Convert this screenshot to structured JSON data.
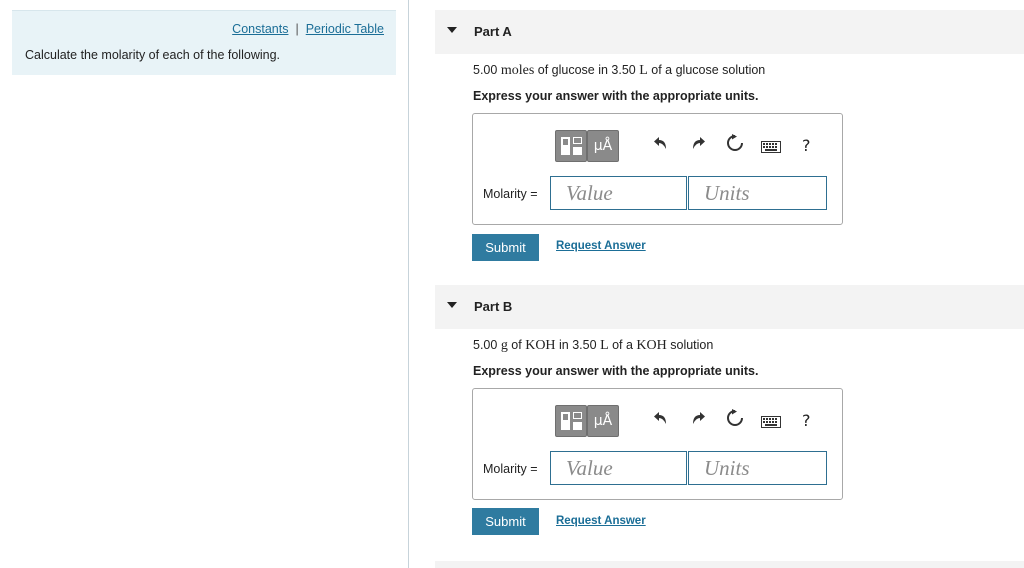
{
  "left_panel": {
    "links": {
      "constants": "Constants",
      "separator": "|",
      "periodic_table": "Periodic Table"
    },
    "intro": "Calculate the molarity of each of the following."
  },
  "part_a": {
    "title": "Part A",
    "question": {
      "amount": "5.00",
      "unit1": "moles",
      "text1": " of glucose in ",
      "volume": "3.50",
      "unit2": "L",
      "text2": " of a glucose solution"
    },
    "instructions": "Express your answer with the appropriate units.",
    "toolbar": {
      "unit_symbol": "μÅ",
      "help": "?"
    },
    "label": "Molarity =",
    "value_placeholder": "Value",
    "units_placeholder": "Units",
    "submit": "Submit",
    "request_answer": "Request Answer"
  },
  "part_b": {
    "title": "Part B",
    "question": {
      "amount": "5.00",
      "unit1": "g",
      "text1": " of ",
      "compound1": "KOH",
      "text_in": " in ",
      "volume": "3.50",
      "unit2": "L",
      "text2": " of a ",
      "compound2": "KOH",
      "text3": " solution"
    },
    "instructions": "Express your answer with the appropriate units.",
    "toolbar": {
      "unit_symbol": "μÅ",
      "help": "?"
    },
    "label": "Molarity =",
    "value_placeholder": "Value",
    "units_placeholder": "Units",
    "submit": "Submit",
    "request_answer": "Request Answer"
  },
  "icons": [
    "templates-icon",
    "units-icon",
    "undo-icon",
    "redo-icon",
    "reset-icon",
    "keyboard-icon",
    "help-icon"
  ],
  "colors": {
    "accent": "#2f7ba0",
    "link": "#1b6e97",
    "panel_bg": "#e8f3f7",
    "header_bg": "#f3f3f3"
  }
}
